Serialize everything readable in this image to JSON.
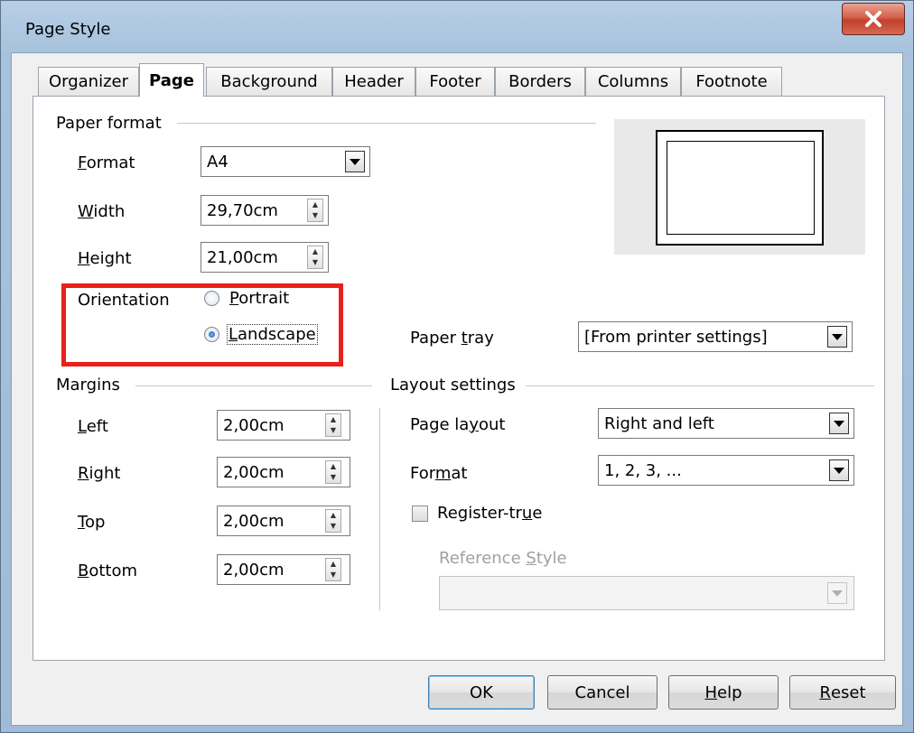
{
  "window": {
    "title": "Page Style",
    "close_label": "x"
  },
  "tabs": [
    {
      "label": "Organizer"
    },
    {
      "label": "Page",
      "active": true
    },
    {
      "label": "Background"
    },
    {
      "label": "Header"
    },
    {
      "label": "Footer"
    },
    {
      "label": "Borders"
    },
    {
      "label": "Columns"
    },
    {
      "label": "Footnote"
    }
  ],
  "paper_format": {
    "group_label": "Paper format",
    "format": {
      "label_pre": "",
      "label_key": "F",
      "label_post": "ormat",
      "value": "A4"
    },
    "width": {
      "label_key": "W",
      "label_post": "idth",
      "value": "29,70cm"
    },
    "height": {
      "label_key": "H",
      "label_post": "eight",
      "value": "21,00cm"
    },
    "orientation": {
      "label": "Orientation",
      "portrait": {
        "key": "P",
        "rest": "ortrait",
        "checked": false
      },
      "landscape": {
        "key": "L",
        "rest": "andscape",
        "checked": true
      }
    },
    "paper_tray": {
      "label_pre": "Paper ",
      "label_key": "t",
      "label_post": "ray",
      "value": "[From printer settings]"
    }
  },
  "margins": {
    "group_label": "Margins",
    "left": {
      "key": "L",
      "rest": "eft",
      "value": "2,00cm"
    },
    "right": {
      "key": "R",
      "rest": "ight",
      "value": "2,00cm"
    },
    "top": {
      "key": "T",
      "rest": "op",
      "value": "2,00cm"
    },
    "bottom": {
      "key": "B",
      "rest": "ottom",
      "value": "2,00cm"
    }
  },
  "layout": {
    "group_label": "Layout settings",
    "page_layout": {
      "label_pre": "Page la",
      "label_key": "y",
      "label_post": "out",
      "value": "Right and left"
    },
    "format": {
      "label_pre": "For",
      "label_key": "m",
      "label_post": "at",
      "value": "1, 2, 3, ..."
    },
    "register_true": {
      "label_pre": "Register-tr",
      "label_key": "u",
      "label_post": "e",
      "checked": false
    },
    "reference_style": {
      "label_pre": "Reference ",
      "label_key": "S",
      "label_post": "tyle",
      "value": ""
    }
  },
  "buttons": {
    "ok": "OK",
    "cancel": "Cancel",
    "help_key": "H",
    "help_rest": "elp",
    "reset_key": "R",
    "reset_rest": "eset"
  },
  "colors": {
    "highlight": "#e8211c",
    "titlebar": "#a7c2dd",
    "close": "#c8503a"
  }
}
